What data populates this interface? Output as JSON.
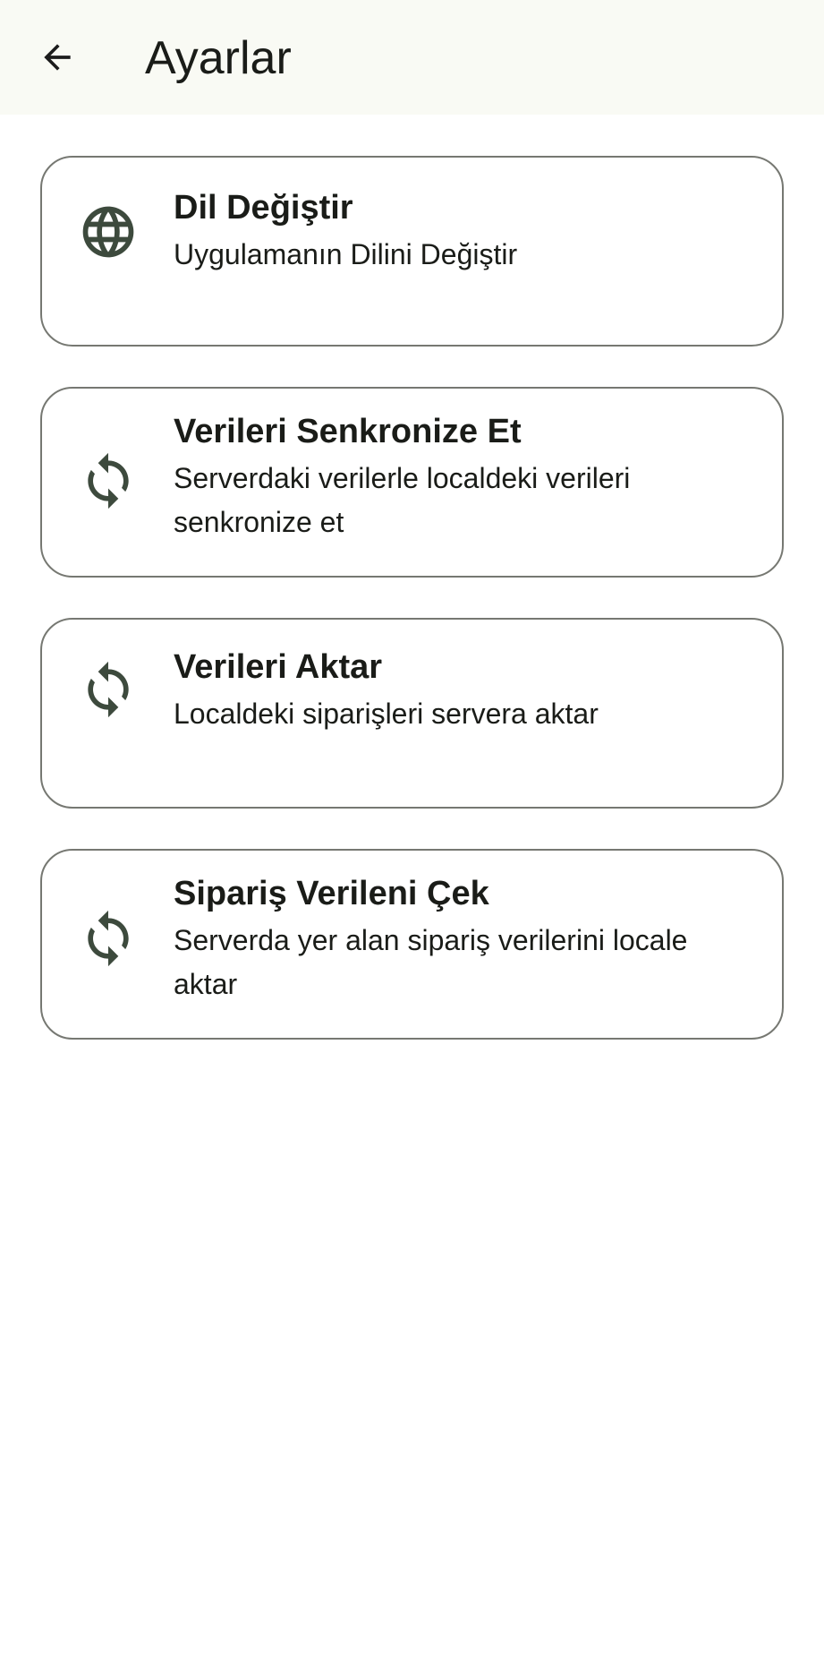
{
  "header": {
    "title": "Ayarlar",
    "back_icon": "arrow-back-icon"
  },
  "theme": {
    "app_bar_bg": "#f9faf4",
    "card_border": "#767872",
    "icon_color": "#3d4a3d",
    "text_color": "#1a1c18"
  },
  "settings": [
    {
      "icon": "globe-icon",
      "title": "Dil Değiştir",
      "subtitle": "Uygulamanın Dilini Değiştir"
    },
    {
      "icon": "sync-icon",
      "title": "Verileri Senkronize Et",
      "subtitle": "Serverdaki verilerle localdeki verileri senkronize et"
    },
    {
      "icon": "sync-icon",
      "title": "Verileri Aktar",
      "subtitle": "Localdeki siparişleri servera aktar"
    },
    {
      "icon": "sync-icon",
      "title": "Sipariş Verileni Çek",
      "subtitle": "Serverda yer alan sipariş verilerini locale aktar"
    }
  ]
}
